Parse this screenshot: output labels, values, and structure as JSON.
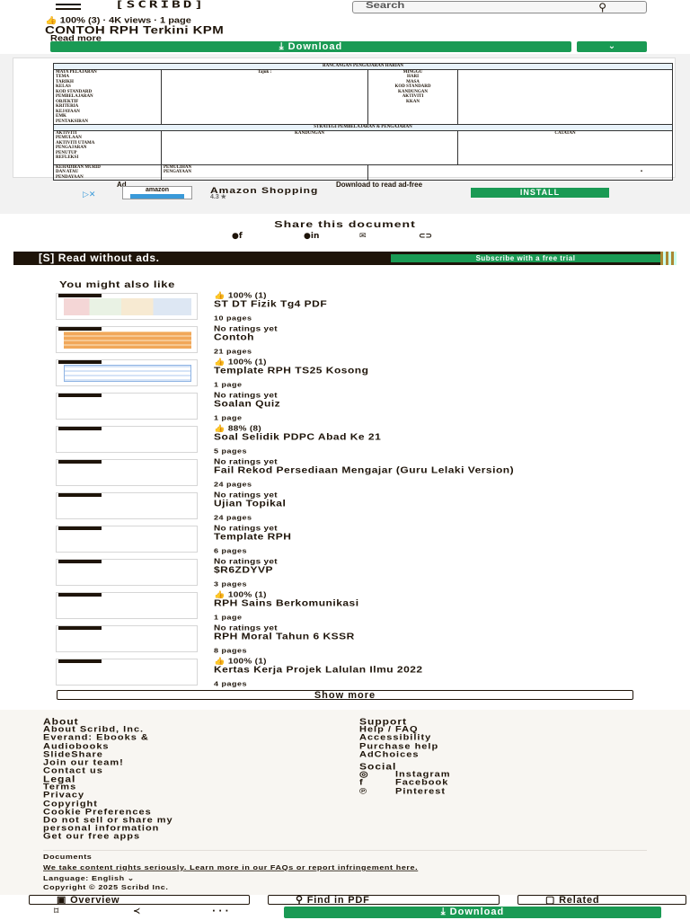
{
  "header": {
    "logo": "[SCRIBD]",
    "search_placeholder": "Search",
    "search_icon": "search-icon"
  },
  "document": {
    "stats": "👍 100% (3) · 4K views · 1 page",
    "title": "CONTOH RPH Terkini KPM",
    "read_more": "Read more",
    "download_label": "⤓ Download",
    "download_caret": "⌄"
  },
  "rph": {
    "heading": "RANCANGAN PENGAJARAN HARIAN",
    "left_labels": [
      "MATA PELAJARAN",
      "TEMA",
      "TARIKH",
      "KELAS",
      "KOD STANDARD",
      "PEMBELAJARAN",
      "OBJEKTIF",
      "KRITERIA",
      "KEJAYAAN",
      "EMK",
      "PENTAKSIRAN"
    ],
    "mid_label": "Tajuk :",
    "right_labels": [
      "MINGGU",
      "HARI",
      "MASA",
      "KOD STANDARD",
      "KANDUNGAN",
      "AKTIVITI",
      "KKAN"
    ],
    "strategy": "STRATEGI PEMBELAJARAN & PENGAJARAN",
    "cols": [
      "KANDUNGAN",
      "CATATAN"
    ],
    "rows": [
      "AKTIVITI",
      "PEMULAAN",
      "AKTIVITI UTAMA",
      "PENGAJARAN",
      "PENUTUP",
      "REFLEKSI"
    ],
    "foot_left": [
      "KEHADIRAN MURID",
      "DAN ATAU",
      "PENDAYAAN"
    ],
    "foot_mid": [
      "PEMULIHAN",
      "PENGAYAAN"
    ]
  },
  "ad": {
    "label": "Ad",
    "note": "Download to read ad-free",
    "brand": "amazon",
    "title": "Amazon Shopping",
    "rating": "4.3 ★",
    "install": "INSTALL"
  },
  "share": {
    "title": "Share this document",
    "icons": [
      "facebook-icon",
      "linkedin-icon",
      "email-icon",
      "link-icon"
    ]
  },
  "promo": {
    "text": "[S] Read without ads.",
    "cta": "Subscribe with a free trial"
  },
  "related": {
    "heading": "You might also like",
    "items": [
      {
        "meta": "👍 100% (1)",
        "title": "ST DT Fizik Tg4 PDF",
        "pages": "10 pages",
        "thumb": "color"
      },
      {
        "meta": "No ratings yet",
        "title": "Contoh",
        "pages": "21 pages",
        "thumb": "orange"
      },
      {
        "meta": "👍 100% (1)",
        "title": "Template RPH TS25 Kosong",
        "pages": "1 page",
        "thumb": "table"
      },
      {
        "meta": "No ratings yet",
        "title": "Soalan Quiz",
        "pages": "1 page",
        "thumb": "blank"
      },
      {
        "meta": "👍 88% (8)",
        "title": "Soal Selidik PDPC Abad Ke 21",
        "pages": "5 pages",
        "thumb": "blank"
      },
      {
        "meta": "No ratings yet",
        "title": "Fail Rekod Persediaan Mengajar (Guru Lelaki Version)",
        "pages": "24 pages",
        "thumb": "blank"
      },
      {
        "meta": "No ratings yet",
        "title": "Ujian Topikal",
        "pages": "24 pages",
        "thumb": "blank"
      },
      {
        "meta": "No ratings yet",
        "title": "Template RPH",
        "pages": "6 pages",
        "thumb": "blank"
      },
      {
        "meta": "No ratings yet",
        "title": "$R6ZDYVP",
        "pages": "3 pages",
        "thumb": "blank"
      },
      {
        "meta": "👍 100% (1)",
        "title": "RPH Sains Berkomunikasi",
        "pages": "1 page",
        "thumb": "blank"
      },
      {
        "meta": "No ratings yet",
        "title": "RPH Moral Tahun 6 KSSR",
        "pages": "8 pages",
        "thumb": "blank"
      },
      {
        "meta": "👍 100% (1)",
        "title": "Kertas Kerja Projek Lalulan Ilmu 2022",
        "pages": "4 pages",
        "thumb": "blank"
      }
    ],
    "show_more": "Show more"
  },
  "footer": {
    "about_heading": "About",
    "about_links": [
      "About Scribd, Inc.",
      "Everand: Ebooks &",
      "Audiobooks",
      "SlideShare",
      "Join our team!",
      "Contact us"
    ],
    "legal_heading": "Legal",
    "legal_links": [
      "Terms",
      "Privacy",
      "Copyright",
      "Cookie Preferences",
      "Do not sell or share my",
      "personal information"
    ],
    "apps": "Get our free apps",
    "support_heading": "Support",
    "support_links": [
      "Help / FAQ",
      "Accessibility",
      "Purchase help",
      "AdChoices"
    ],
    "social_heading": "Social",
    "social_links": [
      {
        "icon": "◎",
        "label": "Instagram"
      },
      {
        "icon": "f",
        "label": "Facebook"
      },
      {
        "icon": "℗",
        "label": "Pinterest"
      }
    ],
    "documents": "Documents",
    "rights": "We take content rights seriously. Learn more in our FAQs or report infringement here.",
    "language": "Language: English ⌄",
    "copyright": "Copyright © 2025 Scribd Inc."
  },
  "toolbar": {
    "overview": "Overview",
    "find": "Find in PDF",
    "related": "Related",
    "download": "⤓ Download",
    "icons": [
      "bookmark-icon",
      "share-icon",
      "more-icon"
    ]
  },
  "colors": {
    "accent": "#1a9a54",
    "dark": "#1e1409",
    "footer_bg": "#f8f6f2"
  }
}
